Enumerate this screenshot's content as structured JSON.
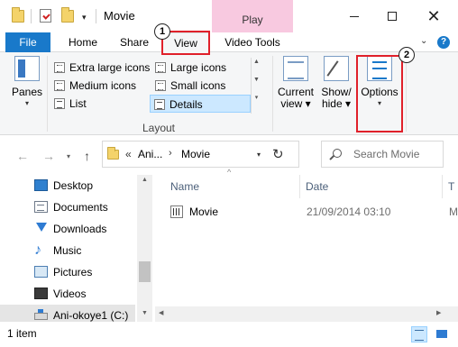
{
  "window": {
    "title": "Movie",
    "contextual_tab": "Play",
    "quick_access_dropdown": "▾",
    "controls": {
      "close": "✕"
    }
  },
  "tabs": {
    "file": "File",
    "home": "Home",
    "share": "Share",
    "view": "View",
    "video_tools": "Video Tools",
    "collapse": "⌄",
    "help": "?"
  },
  "ribbon": {
    "panes": {
      "label": "Panes",
      "caret": "▾"
    },
    "layout": {
      "group_label": "Layout",
      "items": [
        "Extra large icons",
        "Large icons",
        "Medium icons",
        "Small icons",
        "List",
        "Details"
      ],
      "selected": "Details",
      "scroll_up": "▲",
      "scroll_down": "▼",
      "scroll_more": "▾"
    },
    "current_view": {
      "line1": "Current",
      "line2": "view ▾"
    },
    "show_hide": {
      "line1": "Show/",
      "line2": "hide ▾"
    },
    "options": {
      "label": "Options",
      "caret": "▾"
    }
  },
  "annotations": {
    "step1": "1",
    "step2": "2",
    "highlight_color": "#e0202a"
  },
  "address_bar": {
    "back": "←",
    "forward": "→",
    "recent": "▾",
    "up": "↑",
    "overflow": "«",
    "crumbs": [
      "Ani...",
      "Movie"
    ],
    "separator": "›",
    "dropdown": "▾",
    "refresh": "↻"
  },
  "search": {
    "placeholder": "Search Movie"
  },
  "nav_pane": {
    "items": [
      {
        "label": "Desktop",
        "icon": "desktop-icon"
      },
      {
        "label": "Documents",
        "icon": "documents-icon"
      },
      {
        "label": "Downloads",
        "icon": "downloads-icon"
      },
      {
        "label": "Music",
        "icon": "music-icon",
        "glyph": "♪"
      },
      {
        "label": "Pictures",
        "icon": "pictures-icon"
      },
      {
        "label": "Videos",
        "icon": "videos-icon"
      },
      {
        "label": "Ani-okoye1 (C:)",
        "icon": "drive-icon",
        "selected": true
      }
    ],
    "scroll_up": "▲",
    "scroll_down": "▼"
  },
  "file_list": {
    "sort_indicator": "^",
    "columns": {
      "name": "Name",
      "date": "Date",
      "more": "T"
    },
    "rows": [
      {
        "name": "Movie",
        "date": "21/09/2014 03:10",
        "more": "M"
      }
    ],
    "scroll_left": "◀",
    "scroll_right": "▶"
  },
  "status_bar": {
    "item_count": "1 item",
    "active_view": "details"
  },
  "colors": {
    "accent": "#1979ca",
    "contextual_tab": "#f8c9e0",
    "selection": "#cce8ff"
  }
}
